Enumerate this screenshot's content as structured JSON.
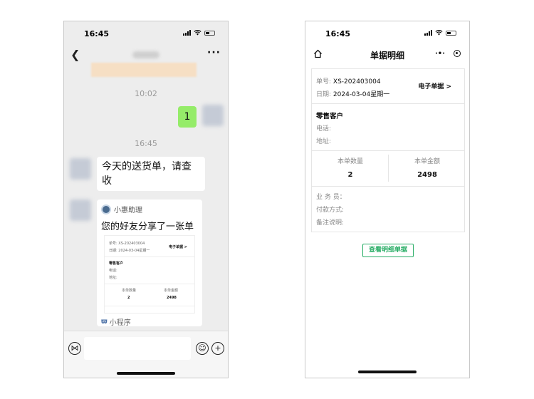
{
  "left_phone": {
    "status_time": "16:45",
    "timestamp_1": "10:02",
    "sent_message": "1",
    "timestamp_2": "16:45",
    "received_message": "今天的送货单，请查收",
    "mini_card": {
      "app_name": "小惠助理",
      "title": "您的好友分享了一张单",
      "preview": {
        "order_no": "单号:  XS-202403004",
        "date": "日期:  2024-03-04星期一",
        "e_receipt": "电子单据 >",
        "customer": "零售客户",
        "phone_label": "电话:",
        "address_label": "地址:",
        "qty_label": "本单数量",
        "qty_value": "2",
        "amount_label": "本单金额",
        "amount_value": "2498"
      },
      "footer_label": "小程序"
    }
  },
  "right_phone": {
    "status_time": "16:45",
    "title": "单据明细",
    "order_no_label": "单号:",
    "order_no": "XS-202403004",
    "date_label": "日期:",
    "date": "2024-03-04星期一",
    "e_receipt_link": "电子单据 >",
    "customer_name": "零售客户",
    "phone_label": "电话:",
    "address_label": "地址:",
    "qty_label": "本单数量",
    "qty_value": "2",
    "amount_label": "本单金额",
    "amount_value": "2498",
    "salesperson_label": "业 务 员：",
    "payment_label": "付款方式:",
    "remark_label": "备注说明:",
    "view_detail_button": "查看明细单据"
  },
  "colors": {
    "chat_background": "#ededed",
    "sent_bubble": "#95ec69",
    "accent_green": "#2aae67"
  },
  "icons": [
    "back-icon",
    "more-icon",
    "voice-icon",
    "emoji-icon",
    "add-icon",
    "home-icon",
    "capsule-more-icon",
    "capsule-close-icon",
    "signal-icon",
    "wifi-icon",
    "battery-icon",
    "mini-program-icon"
  ]
}
